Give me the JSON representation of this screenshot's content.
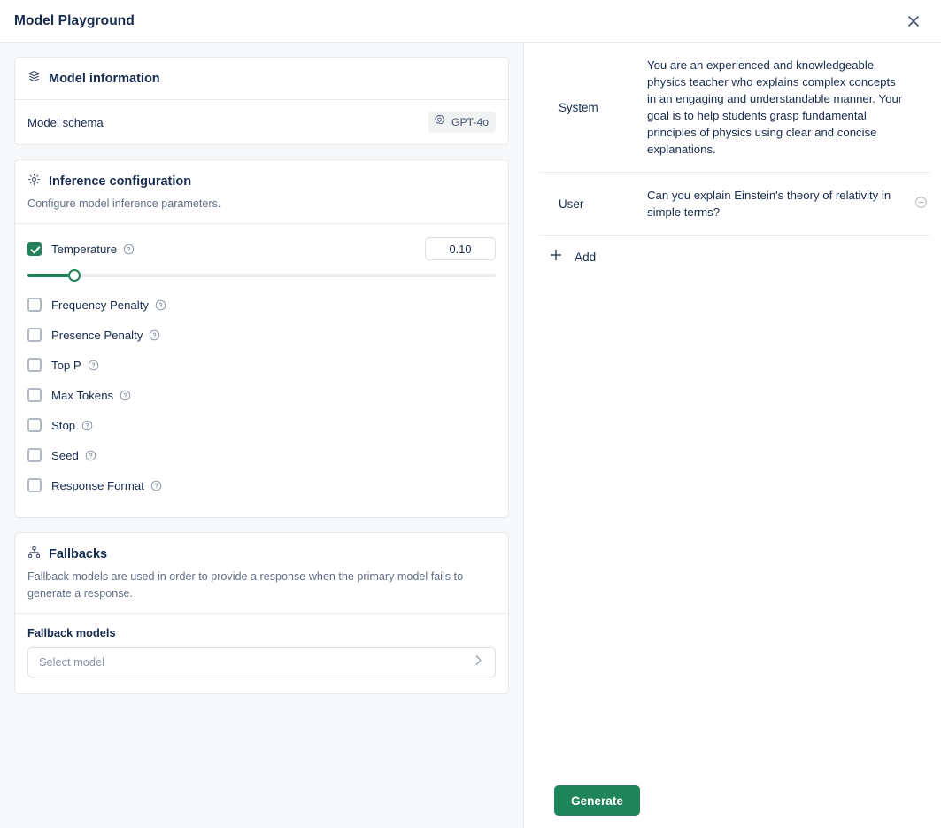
{
  "header": {
    "title": "Model Playground",
    "close_icon": "close-icon"
  },
  "model_information": {
    "icon": "layers-icon",
    "title": "Model information",
    "schema_label": "Model schema",
    "model_badge": {
      "icon": "openai-icon",
      "label": "GPT-4o"
    }
  },
  "inference_configuration": {
    "icon": "gear-icon",
    "title": "Inference configuration",
    "description": "Configure model inference parameters.",
    "params": [
      {
        "label": "Temperature",
        "checked": true,
        "value": "0.10",
        "slider_percent": 10,
        "help_icon": "help-icon"
      },
      {
        "label": "Frequency Penalty",
        "checked": false,
        "help_icon": "help-icon"
      },
      {
        "label": "Presence Penalty",
        "checked": false,
        "help_icon": "help-icon"
      },
      {
        "label": "Top P",
        "checked": false,
        "help_icon": "help-icon"
      },
      {
        "label": "Max Tokens",
        "checked": false,
        "help_icon": "help-icon"
      },
      {
        "label": "Stop",
        "checked": false,
        "help_icon": "help-icon"
      },
      {
        "label": "Seed",
        "checked": false,
        "help_icon": "help-icon"
      },
      {
        "label": "Response Format",
        "checked": false,
        "help_icon": "help-icon"
      }
    ]
  },
  "fallbacks": {
    "icon": "hierarchy-icon",
    "title": "Fallbacks",
    "description": "Fallback models are used in order to provide a response when the primary model fails to generate a response.",
    "field_label": "Fallback models",
    "select_placeholder": "Select model",
    "chevron_icon": "chevron-right-icon"
  },
  "messages": [
    {
      "role": "System",
      "text": "You are an experienced and knowledgeable physics teacher who explains complex concepts in an engaging and understandable manner. Your goal is to help students grasp fundamental principles of physics using clear and concise explanations.",
      "removable": false
    },
    {
      "role": "User",
      "text": "Can you explain Einstein's theory of relativity in simple terms?",
      "removable": true,
      "remove_icon": "minus-circle-icon"
    }
  ],
  "add_message": {
    "icon": "plus-icon",
    "label": "Add"
  },
  "generate": {
    "label": "Generate"
  },
  "colors": {
    "accent_green": "#1f845a",
    "left_pane_bg": "#f7f8f9",
    "border": "#e6e8eb",
    "text_primary": "#172b4d",
    "text_muted": "#626f86"
  }
}
